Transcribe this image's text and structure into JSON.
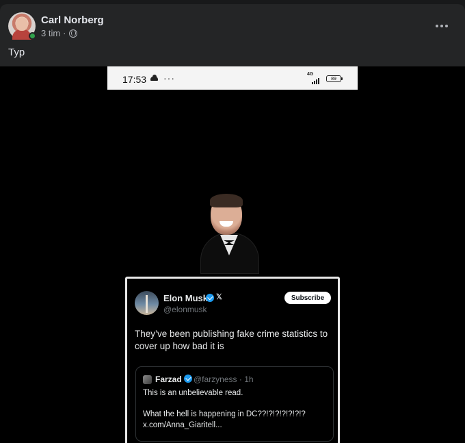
{
  "post": {
    "author": "Carl Norberg",
    "timestamp": "3 tim",
    "separator": "·",
    "privacy_icon": "globe-icon",
    "text": "Typ",
    "more_icon": "more-horizontal-icon"
  },
  "screenshot": {
    "status_bar": {
      "time": "17:53",
      "icons": [
        "cloud-icon",
        "dots-icon"
      ],
      "network_label": "4G",
      "battery": "89"
    },
    "tweet": {
      "author": "Elon Musk",
      "handle": "@elonmusk",
      "subscribe_label": "Subscribe",
      "x_mark": "𝕏",
      "body": "They’ve been publishing fake crime statistics to cover up how bad it is",
      "quote": {
        "author": "Farzad",
        "handle": "@farzyness · 1h",
        "line1": "This is an unbelievable read.",
        "line2": "What the hell is happening in DC??!?!?!?!?!?!?",
        "line3": "x.com/Anna_Giaritell..."
      }
    }
  },
  "colors": {
    "background": "#18191a",
    "card": "#242526",
    "online": "#31a24c",
    "verified": "#1d9bf0"
  }
}
